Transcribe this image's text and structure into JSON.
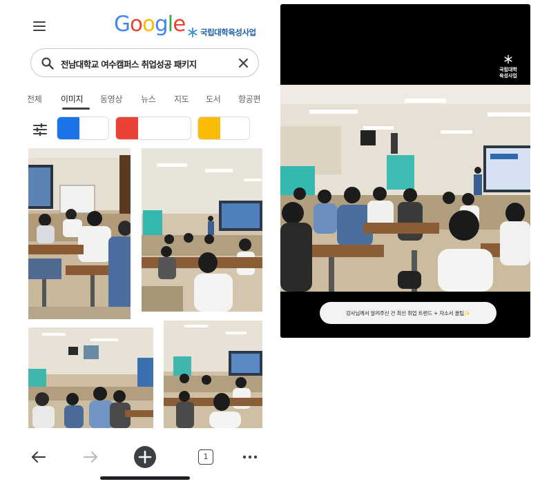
{
  "header": {
    "logo_letters": [
      {
        "ch": "G",
        "color": "#4285F4"
      },
      {
        "ch": "o",
        "color": "#EA4335"
      },
      {
        "ch": "o",
        "color": "#FBBC05"
      },
      {
        "ch": "g",
        "color": "#4285F4"
      },
      {
        "ch": "l",
        "color": "#34A853"
      },
      {
        "ch": "e",
        "color": "#EA4335"
      }
    ],
    "brand_text": "국립대학육성사업"
  },
  "search": {
    "query": "전남대학교 여수캠퍼스 취업성공 패키지"
  },
  "tabs": [
    {
      "label": "전체",
      "active": false
    },
    {
      "label": "이미지",
      "active": true
    },
    {
      "label": "동영상",
      "active": false
    },
    {
      "label": "뉴스",
      "active": false
    },
    {
      "label": "지도",
      "active": false
    },
    {
      "label": "도서",
      "active": false
    },
    {
      "label": "항공편",
      "active": false
    }
  ],
  "color_filters": [
    {
      "color": "#1a73e8"
    },
    {
      "color": "#ea4335"
    },
    {
      "color": "#fbbc04"
    }
  ],
  "bottom_nav": {
    "tab_count": "1"
  },
  "video": {
    "logo_text_line1": "국립대학",
    "logo_text_line2": "육성사업",
    "caption": "강사님께서 알려주신 건 최신 취업 트렌드 + 자소서 꿀팁✨"
  },
  "colors": {
    "search_border": "#c4c7c5",
    "text_primary": "#202124",
    "text_secondary": "#5f6368",
    "brand_blue": "#1a5fa8"
  }
}
